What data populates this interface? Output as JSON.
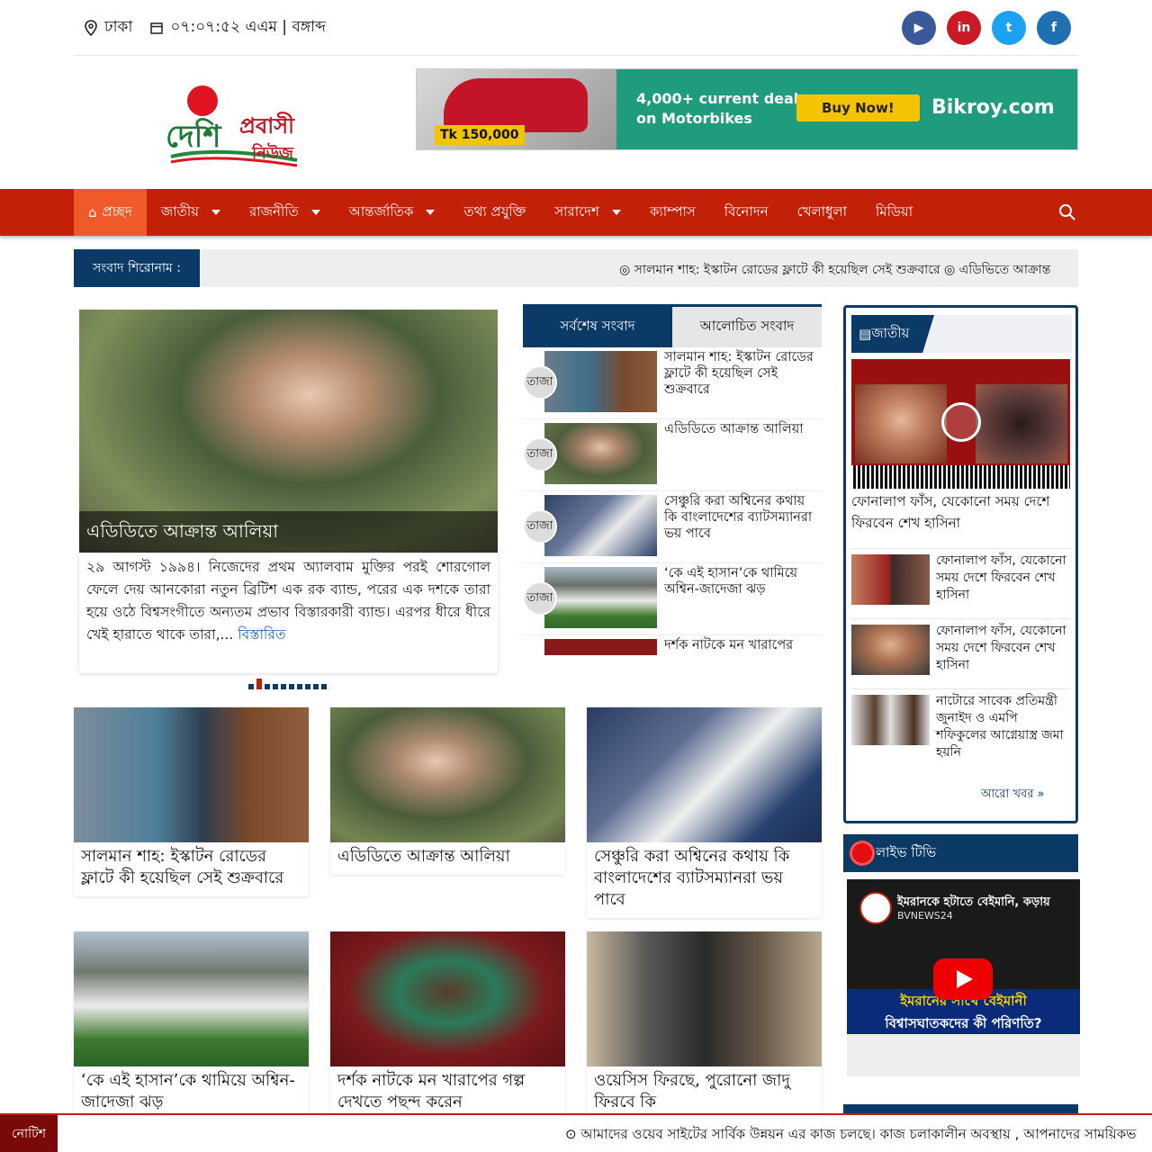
{
  "topbar": {
    "location": "ঢাকা",
    "datetime": "০৭:০৭:৫২ এএম | বঙ্গাব্দ",
    "social": [
      "youtube-icon",
      "linkedin-icon",
      "twitter-icon",
      "facebook-icon"
    ],
    "social_colors": [
      "#3b5998",
      "#c91a25",
      "#1da1f2",
      "#1f6fb3"
    ]
  },
  "logo": {
    "line1": "দেশি",
    "line2": "প্রবাসী",
    "line3": "নিউজ"
  },
  "ad": {
    "price": "Tk 150,000",
    "text1": "4,000+ current deals",
    "text2": "on Motorbikes",
    "button": "Buy Now!",
    "brand": "Bikroy.com"
  },
  "nav": {
    "items": [
      {
        "label": "প্রচ্ছদ",
        "active": true
      },
      {
        "label": "জাতীয়",
        "dropdown": true
      },
      {
        "label": "রাজনীতি",
        "dropdown": true
      },
      {
        "label": "আন্তর্জাতিক",
        "dropdown": true
      },
      {
        "label": "তথ্য প্রযুক্তি"
      },
      {
        "label": "সারাদেশ",
        "dropdown": true
      },
      {
        "label": "ক্যাম্পাস"
      },
      {
        "label": "বিনোদন"
      },
      {
        "label": "খেলাধুলা"
      },
      {
        "label": "মিডিয়া"
      }
    ]
  },
  "ticker": {
    "label": "সংবাদ শিরোনাম :",
    "text": "◎ সালমান শাহ: ইস্কাটন রোডের ফ্লাটে কী হয়েছিল সেই শুক্রবারে   ◎ এডিভিতে আক্রান্ত"
  },
  "featured": {
    "caption": "এডিডিতে আক্রান্ত আলিয়া",
    "description": "২৯ আগস্ট ১৯৯৪। নিজেদের প্রথম অ্যালবাম মুক্তির পরই শোরগোল ফেলে দেয় আনকোরা নতুন ব্রিটিশ এক রক ব্যান্ড, পরের এক দশকে তারা হয়ে ওঠে বিশ্বসংগীতে অন্যতম প্রভাব বিস্তারকারী ব্যান্ড। এরপর ধীরে ধীরে খেই হারাতে থাকে তারা,...",
    "more": "বিস্তারিত"
  },
  "tabs": {
    "latest": "সর্বশেষ সংবাদ",
    "popular": "আলোচিত সংবাদ"
  },
  "latest": [
    {
      "badge": "তাজা",
      "title": "সালমান শাহ: ইস্কাটন রোডের ফ্লাটে কী হয়েছিল সেই শুক্রবারে"
    },
    {
      "badge": "তাজা",
      "title": "এডিডিতে আক্রান্ত আলিয়া"
    },
    {
      "badge": "তাজা",
      "title": "সেঞ্চুরি করা অশ্বিনের কথায় কি বাংলাদেশের ব্যাটসম্যানরা ভয় পাবে"
    },
    {
      "badge": "তাজা",
      "title": "‘কে এই হাসান’কে থামিয়ে অশ্বিন-জাদেজা ঝড়"
    },
    {
      "badge": "",
      "title": "দর্শক নাটকে মন খারাপের"
    }
  ],
  "cards": [
    {
      "title": "সালমান শাহ: ইস্কাটন রোডের ফ্লাটে কী হয়েছিল সেই শুক্রবারে"
    },
    {
      "title": "এডিডিতে আক্রান্ত আলিয়া"
    },
    {
      "title": "সেঞ্চুরি করা অশ্বিনের কথায় কি বাংলাদেশের ব্যাটসম্যানরা ভয় পাবে"
    },
    {
      "title": "‘কে এই হাসান’কে থামিয়ে অশ্বিন-জাদেজা ঝড়"
    },
    {
      "title": "দর্শক নাটকে মন খারাপের গল্প দেখতে পছন্দ করেন"
    },
    {
      "title": "ওয়েসিস ফিরছে, পুরোনো জাদু ফিরবে কি"
    }
  ],
  "sidebar": {
    "heading": "জাতীয়",
    "big_title": "ফোনালাপ ফাঁস, যেকোনো সময় দেশে ফিরবেন শেখ হাসিনা",
    "rows": [
      {
        "title": "ফোনালাপ ফাঁস, যেকোনো সময় দেশে ফিরবেন শেখ হাসিনা"
      },
      {
        "title": "ফোনালাপ ফাঁস, যেকোনো সময় দেশে ফিরবেন শেখ হাসিনা"
      },
      {
        "title": "নাটোরে সাবেক প্রতিমন্ত্রী জুনাইদ ও এমপি শফিকুলের আগ্নেয়াস্ত্র জমা হয়নি"
      }
    ],
    "more": "আরো খবর »"
  },
  "live": {
    "label": "লাইভ টিভি",
    "video_title": "ইমরানকে হটাতে বেইমানি, কড়ায়",
    "channel": "BVNEWS24",
    "band_line1": "ইমরানের সাথে বেইমানী",
    "band_line2": "বিশ্বাসঘাতকদের কী পরিণতি?"
  },
  "notice": {
    "label": "নোটিশ",
    "text": "⊙ আমাদের ওয়েব সাইটের সার্বিক উন্নয়ন এর কাজ চলছে। কাজ চলাকালীন অবস্থায় , আপনাদের সাময়িকভ"
  }
}
